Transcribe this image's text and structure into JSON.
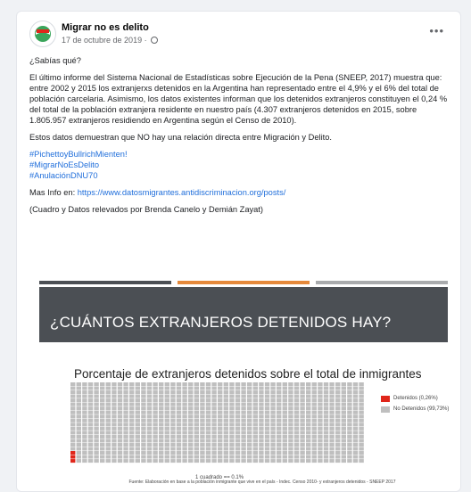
{
  "post": {
    "page_name": "Migrar no es delito",
    "date": "17 de octubre de 2019 ·",
    "more_label": "•••",
    "paragraphs": [
      "¿Sabías qué?",
      "El último informe del Sistema Nacional de Estadísticas sobre Ejecución de la Pena (SNEEP, 2017) muestra que:",
      "entre 2002 y 2015 los extranjerxs detenidos en la Argentina han representado entre el 4,9% y el 6% del total de población carcelaria. Asimismo, los datos existentes informan que los detenidos extranjeros constituyen el 0,24 % del total de la población extranjera residente en nuestro país (4.307 extranjeros detenidos en 2015, sobre 1.805.957 extranjeros residiendo en Argentina según el Censo de 2010).",
      "Estos datos demuestran que NO hay una relación directa entre Migración y Delito."
    ],
    "hashtags": [
      "#PichettoyBullrichMienten!",
      "#MigrarNoEsDelito",
      "#AnulaciónDNU70"
    ],
    "more_info_label": "Mas Info en: ",
    "more_info_link": "https://www.datosmigrantes.antidiscriminacion.org/posts/",
    "credits": "(Cuadro y Datos relevados por Brenda Canelo y Demián Zayat)"
  },
  "infographic": {
    "stripe_colors": [
      "#4b4f54",
      "#e5893b",
      "#a9abad"
    ],
    "header_bg": "#4b4f54",
    "title": "¿CUÁNTOS EXTRANJEROS DETENIDOS HAY?",
    "chart_title": "Porcentaje de extranjeros detenidos sobre el total de inmigrantes",
    "scale_note": "1 cuadrado == 0.1%",
    "source": "Fuente: Elaboración en base a la población inmigrante que vive en el país - Indec. Censo 2010- y extranjeros detenidos - SNEEP 2017"
  },
  "chart_data": {
    "type": "waffle",
    "cells_total": 1000,
    "columns": 50,
    "rows": 20,
    "unit": "1 cuadrado == 0.1%",
    "categories": [
      "Detenidos (0,26%)",
      "No Detenidos (99,73%)"
    ],
    "percent": [
      0.26,
      99.73
    ],
    "colors": [
      "#e0261b",
      "#bfbfbf"
    ]
  }
}
